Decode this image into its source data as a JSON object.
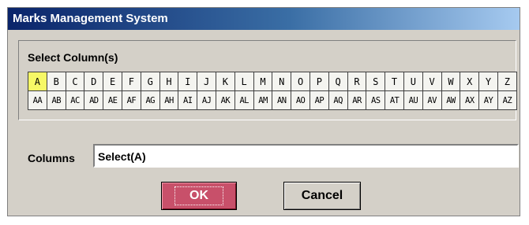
{
  "window": {
    "title": "Marks Management System"
  },
  "select_group": {
    "label": "Select Column(s)"
  },
  "columns_row1": [
    "A",
    "B",
    "C",
    "D",
    "E",
    "F",
    "G",
    "H",
    "I",
    "J",
    "K",
    "L",
    "M",
    "N",
    "O",
    "P",
    "Q",
    "R",
    "S",
    "T",
    "U",
    "V",
    "W",
    "X",
    "Y",
    "Z"
  ],
  "columns_row2": [
    "AA",
    "AB",
    "AC",
    "AD",
    "AE",
    "AF",
    "AG",
    "AH",
    "AI",
    "AJ",
    "AK",
    "AL",
    "AM",
    "AN",
    "AO",
    "AP",
    "AQ",
    "AR",
    "AS",
    "AT",
    "AU",
    "AV",
    "AW",
    "AX",
    "AY",
    "AZ"
  ],
  "selected_column": "A",
  "columns_field": {
    "label": "Columns",
    "value": "Select(A)"
  },
  "buttons": {
    "ok": "OK",
    "cancel": "Cancel"
  },
  "colors": {
    "title_bar": "#0a246a",
    "selected_cell": "#f6f866",
    "ok_button": "#c8506a",
    "dialog_bg": "#d4d0c8"
  }
}
